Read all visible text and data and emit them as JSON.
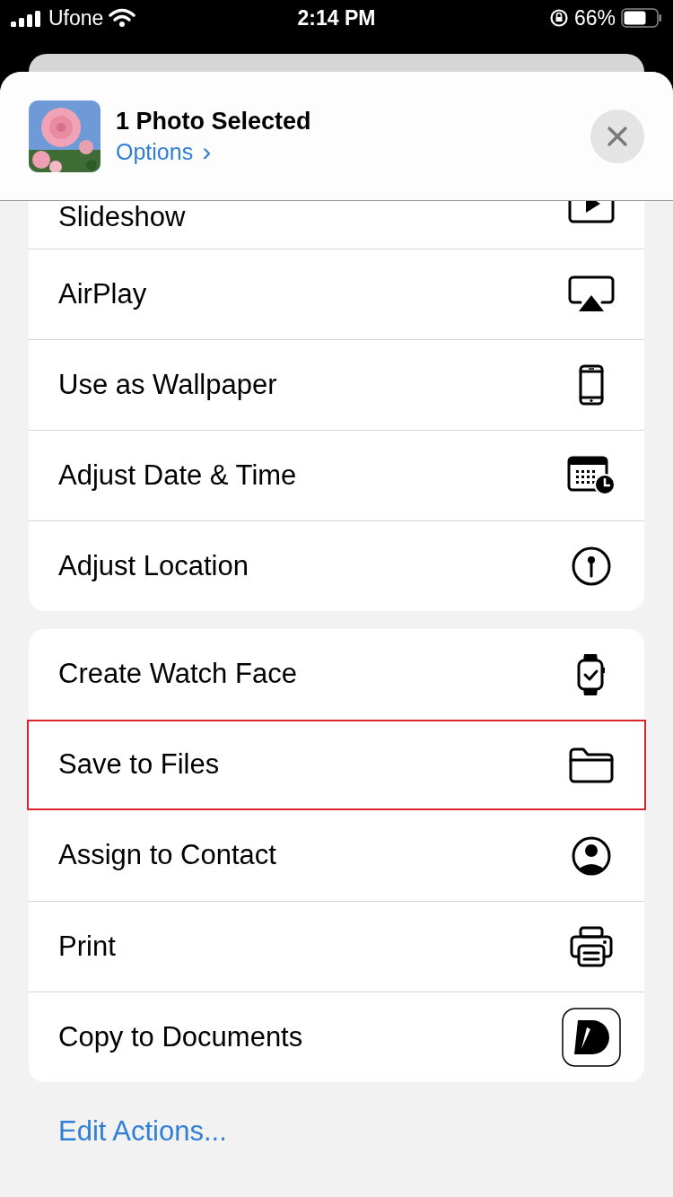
{
  "status_bar": {
    "carrier": "Ufone",
    "time": "2:14 PM",
    "battery": "66%"
  },
  "header": {
    "title": "1 Photo Selected",
    "options": "Options",
    "options_chevron": "›"
  },
  "groups": [
    {
      "actions": [
        {
          "label": "Slideshow",
          "kind": "play",
          "highlighted": false
        },
        {
          "label": "AirPlay",
          "kind": "airplay",
          "highlighted": false
        },
        {
          "label": "Use as Wallpaper",
          "kind": "phone",
          "highlighted": false
        },
        {
          "label": "Adjust Date & Time",
          "kind": "calendar",
          "highlighted": false
        },
        {
          "label": "Adjust Location",
          "kind": "pin",
          "highlighted": false
        }
      ]
    },
    {
      "actions": [
        {
          "label": "Create Watch Face",
          "kind": "watch",
          "highlighted": false
        },
        {
          "label": "Save to Files",
          "kind": "folder",
          "highlighted": true
        },
        {
          "label": "Assign to Contact",
          "kind": "person",
          "highlighted": false
        },
        {
          "label": "Print",
          "kind": "printer",
          "highlighted": false
        },
        {
          "label": "Copy to Documents",
          "kind": "docs",
          "highlighted": false
        }
      ]
    }
  ],
  "edit_actions": "Edit Actions..."
}
